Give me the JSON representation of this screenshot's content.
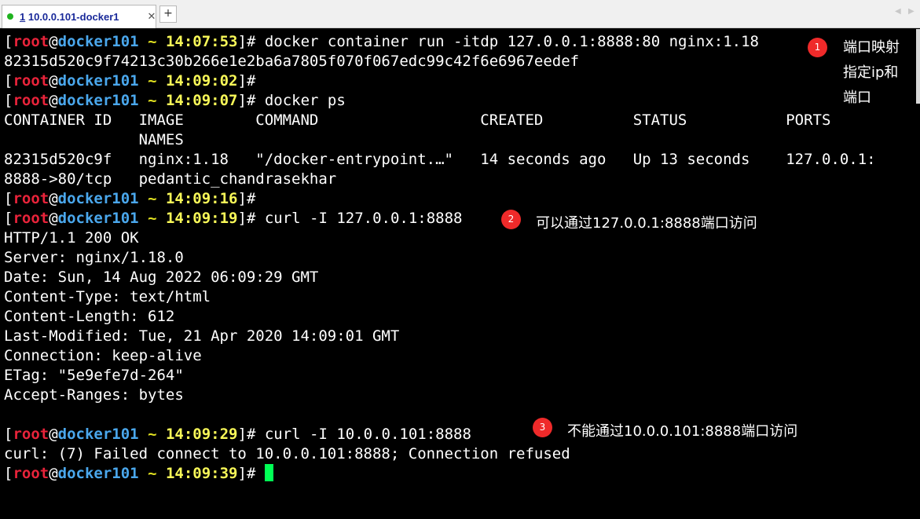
{
  "tab": {
    "number": "1",
    "title": "10.0.0.101-docker1",
    "close": "✕",
    "add": "+"
  },
  "nav": {
    "left": "◀",
    "right": "▶"
  },
  "prompt": {
    "open": "[",
    "user": "root",
    "at": "@",
    "host": "docker101",
    "tilde": "~",
    "close": "]#"
  },
  "lines": [
    {
      "type": "prompt",
      "time": "14:07:53",
      "cmd": " docker container run -itdp 127.0.0.1:8888:80 nginx:1.18"
    },
    {
      "type": "out",
      "text": "82315d520c9f74213c30b266e1e2ba6a7805f070f067edc99c42f6e6967eedef"
    },
    {
      "type": "prompt",
      "time": "14:09:02",
      "cmd": ""
    },
    {
      "type": "prompt",
      "time": "14:09:07",
      "cmd": " docker ps"
    },
    {
      "type": "out",
      "text": "CONTAINER ID   IMAGE        COMMAND                  CREATED          STATUS           PORTS"
    },
    {
      "type": "out",
      "text": "               NAMES"
    },
    {
      "type": "out",
      "text": "82315d520c9f   nginx:1.18   \"/docker-entrypoint.…\"   14 seconds ago   Up 13 seconds    127.0.0.1:"
    },
    {
      "type": "out",
      "text": "8888->80/tcp   pedantic_chandrasekhar"
    },
    {
      "type": "prompt",
      "time": "14:09:16",
      "cmd": ""
    },
    {
      "type": "prompt",
      "time": "14:09:19",
      "cmd": " curl -I 127.0.0.1:8888"
    },
    {
      "type": "out",
      "text": "HTTP/1.1 200 OK"
    },
    {
      "type": "out",
      "text": "Server: nginx/1.18.0"
    },
    {
      "type": "out",
      "text": "Date: Sun, 14 Aug 2022 06:09:29 GMT"
    },
    {
      "type": "out",
      "text": "Content-Type: text/html"
    },
    {
      "type": "out",
      "text": "Content-Length: 612"
    },
    {
      "type": "out",
      "text": "Last-Modified: Tue, 21 Apr 2020 14:09:01 GMT"
    },
    {
      "type": "out",
      "text": "Connection: keep-alive"
    },
    {
      "type": "out",
      "text": "ETag: \"5e9efe7d-264\""
    },
    {
      "type": "out",
      "text": "Accept-Ranges: bytes"
    },
    {
      "type": "out",
      "text": ""
    },
    {
      "type": "prompt",
      "time": "14:09:29",
      "cmd": " curl -I 10.0.0.101:8888"
    },
    {
      "type": "out",
      "text": "curl: (7) Failed connect to 10.0.0.101:8888; Connection refused"
    },
    {
      "type": "prompt",
      "time": "14:09:39",
      "cmd": " ",
      "cursor": true
    }
  ],
  "annotations": [
    {
      "badge": "1",
      "text_lines": [
        "端口映射",
        "指定ip和",
        "端口"
      ]
    },
    {
      "badge": "2",
      "text": "可以通过127.0.0.1:8888端口访问"
    },
    {
      "badge": "3",
      "text": "不能通过10.0.0.101:8888端口访问"
    }
  ],
  "colors": {
    "user": "#e8233a",
    "host": "#4aa7ec",
    "time": "#f8f858",
    "cursor": "#00ff55",
    "badge": "#ef2a2a"
  }
}
